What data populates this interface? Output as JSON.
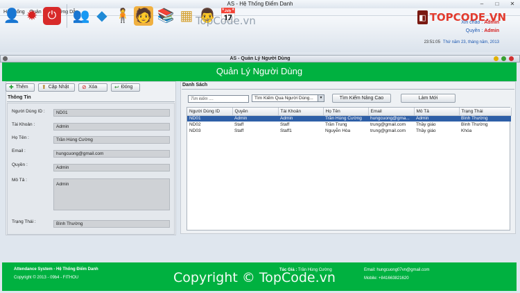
{
  "window": {
    "title": "AS - Hệ Thống Điểm Danh",
    "minimize": "–",
    "maximize": "□",
    "close": "✕"
  },
  "menu": [
    "Hệ Thống",
    "Quản Lý",
    "Hướng Dẫn"
  ],
  "toolbar_icons": [
    "users-logout-icon",
    "settings-gear-icon",
    "power-icon",
    "group-icon",
    "cube-icon",
    "person-icon",
    "user-card-icon",
    "books-icon",
    "grid-icon",
    "teacher-icon",
    "calendar-icon"
  ],
  "brand": {
    "text": "TOPCODE.VN"
  },
  "watermark_mid": "TopCode.vn",
  "greeting": {
    "label": "Xin chào :",
    "value": "Admin"
  },
  "role": {
    "label": "Quyền :",
    "value": "Admin"
  },
  "clock": {
    "time": "23:51:05",
    "date": "Thứ năm  23, tháng năm,  2013"
  },
  "subwindow": {
    "title": "AS - Quản Lý Người Dùng"
  },
  "header": {
    "title": "Quản Lý Người Dùng"
  },
  "actions": {
    "add": "Thêm",
    "update": "Cập Nhật",
    "delete": "Xóa",
    "close": "Đóng"
  },
  "info": {
    "title": "Thông Tin",
    "labels": {
      "id": "Người Dùng ID :",
      "account": "Tài Khoản :",
      "name": "Họ Tên :",
      "email": "Email :",
      "role": "Quyền :",
      "desc": "Mô Tả :",
      "status": "Trạng Thái :"
    },
    "values": {
      "id": "ND01",
      "account": "Admin",
      "name": "Trần Hùng Cường",
      "email": "hungcuong@gmail.com",
      "role": "Admin",
      "desc": "Admin",
      "status": "Bình Thường"
    }
  },
  "list": {
    "title": "Danh Sách",
    "search_placeholder": "Tìm kiếm ....",
    "search_by": "Tìm Kiếm Qua Người Dùng...",
    "advanced": "Tìm Kiếm Nâng Cao",
    "refresh": "Làm Mới",
    "columns": [
      "Người Dùng ID",
      "Quyền",
      "Tài Khoản",
      "Họ Tên",
      "Email",
      "Mô Tả",
      "Trạng Thái"
    ],
    "rows": [
      [
        "ND01",
        "Admin",
        "Admin",
        "Trần Hùng Cường",
        "hungcuong@gma...",
        "Admin",
        "Bình Thường"
      ],
      [
        "ND02",
        "Staff",
        "Staff",
        "Trần Trung",
        "trung@gmail.com",
        "Thầy giáo",
        "Bình Thường"
      ],
      [
        "ND03",
        "Staff",
        "Staff1",
        "Nguyễn Hòa",
        "trung@gmail.com",
        "Thầy giáo",
        "Khóa"
      ]
    ]
  },
  "footer": {
    "system": "Attendance System - Hệ Thống Điểm Danh",
    "copyright": "Copyright © 2013 - 09b4 - FITHOU",
    "author_label": "Tác Giả :",
    "author": "Trần Hùng Cường",
    "email": "Email: hungcuong07vn@gmail.com",
    "mobile": "Mobile: +841663821620",
    "watermark": "Copyright © TopCode.vn"
  }
}
